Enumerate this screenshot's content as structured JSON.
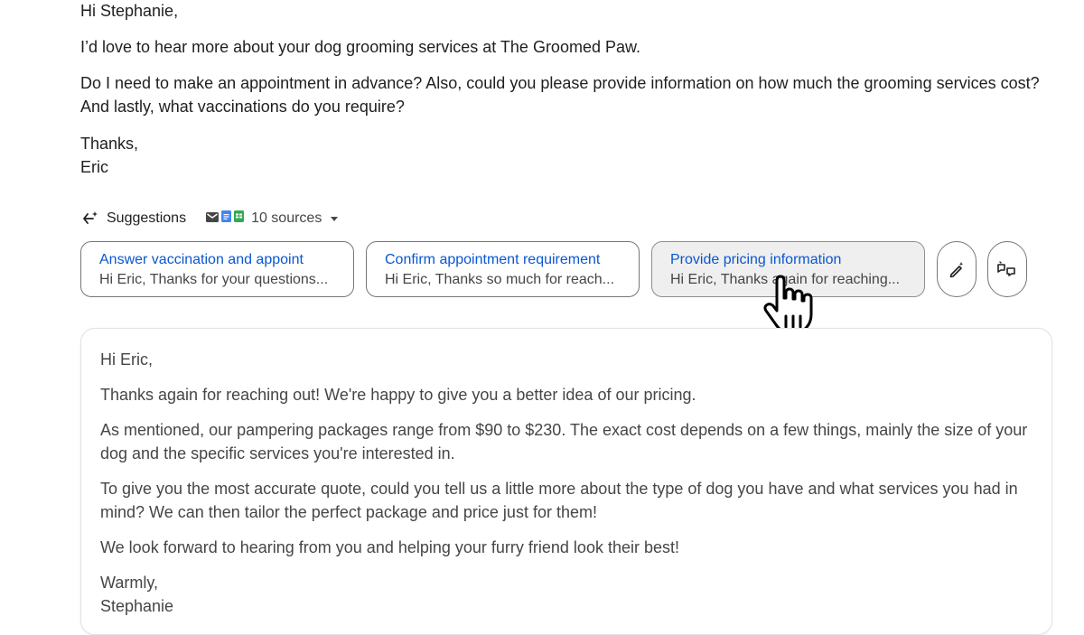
{
  "email": {
    "greeting": "Hi Stephanie,",
    "line1": "I’d love to hear more about your dog grooming services at The Groomed Paw.",
    "line2": "Do I need to make an appointment in advance? Also, could you please provide information on how much the grooming services cost? And lastly, what vaccinations do you require?",
    "signoff": "Thanks,",
    "name": "Eric"
  },
  "suggestions": {
    "label": "Suggestions",
    "sources": "10 sources",
    "source_icons": [
      "gmail-icon",
      "docs-icon",
      "sheets-icon"
    ],
    "chips": [
      {
        "title": "Answer vaccination and appoint",
        "preview": "Hi Eric, Thanks for your questions..."
      },
      {
        "title": "Confirm appointment requirement",
        "preview": "Hi Eric, Thanks so much for reach..."
      },
      {
        "title": "Provide pricing information",
        "preview": "Hi Eric, Thanks again for reaching..."
      }
    ],
    "actions": [
      "magic-pen-icon",
      "refine-icon"
    ]
  },
  "reply": {
    "greeting": "Hi Eric,",
    "p1": "Thanks again for reaching out! We're happy to give you a better idea of our pricing.",
    "p2": "As mentioned, our pampering packages range from $90 to $230. The exact cost depends on a few things, mainly the size of your dog and the specific services you're interested in.",
    "p3": "To give you the most accurate quote, could you tell us a little more about the type of dog you have and what services you had in mind? We can then tailor the perfect package and price just for them!",
    "p4": "We look forward to hearing from you and helping your furry friend look their best!",
    "signoff": "Warmly,",
    "name": "Stephanie"
  },
  "colors": {
    "accent": "#0b57d0",
    "text": "#1f1f1f",
    "muted": "#444746",
    "border": "#747775",
    "gmail_red": "#ea4335",
    "docs_blue": "#4285f4",
    "sheets_green": "#34a853"
  }
}
